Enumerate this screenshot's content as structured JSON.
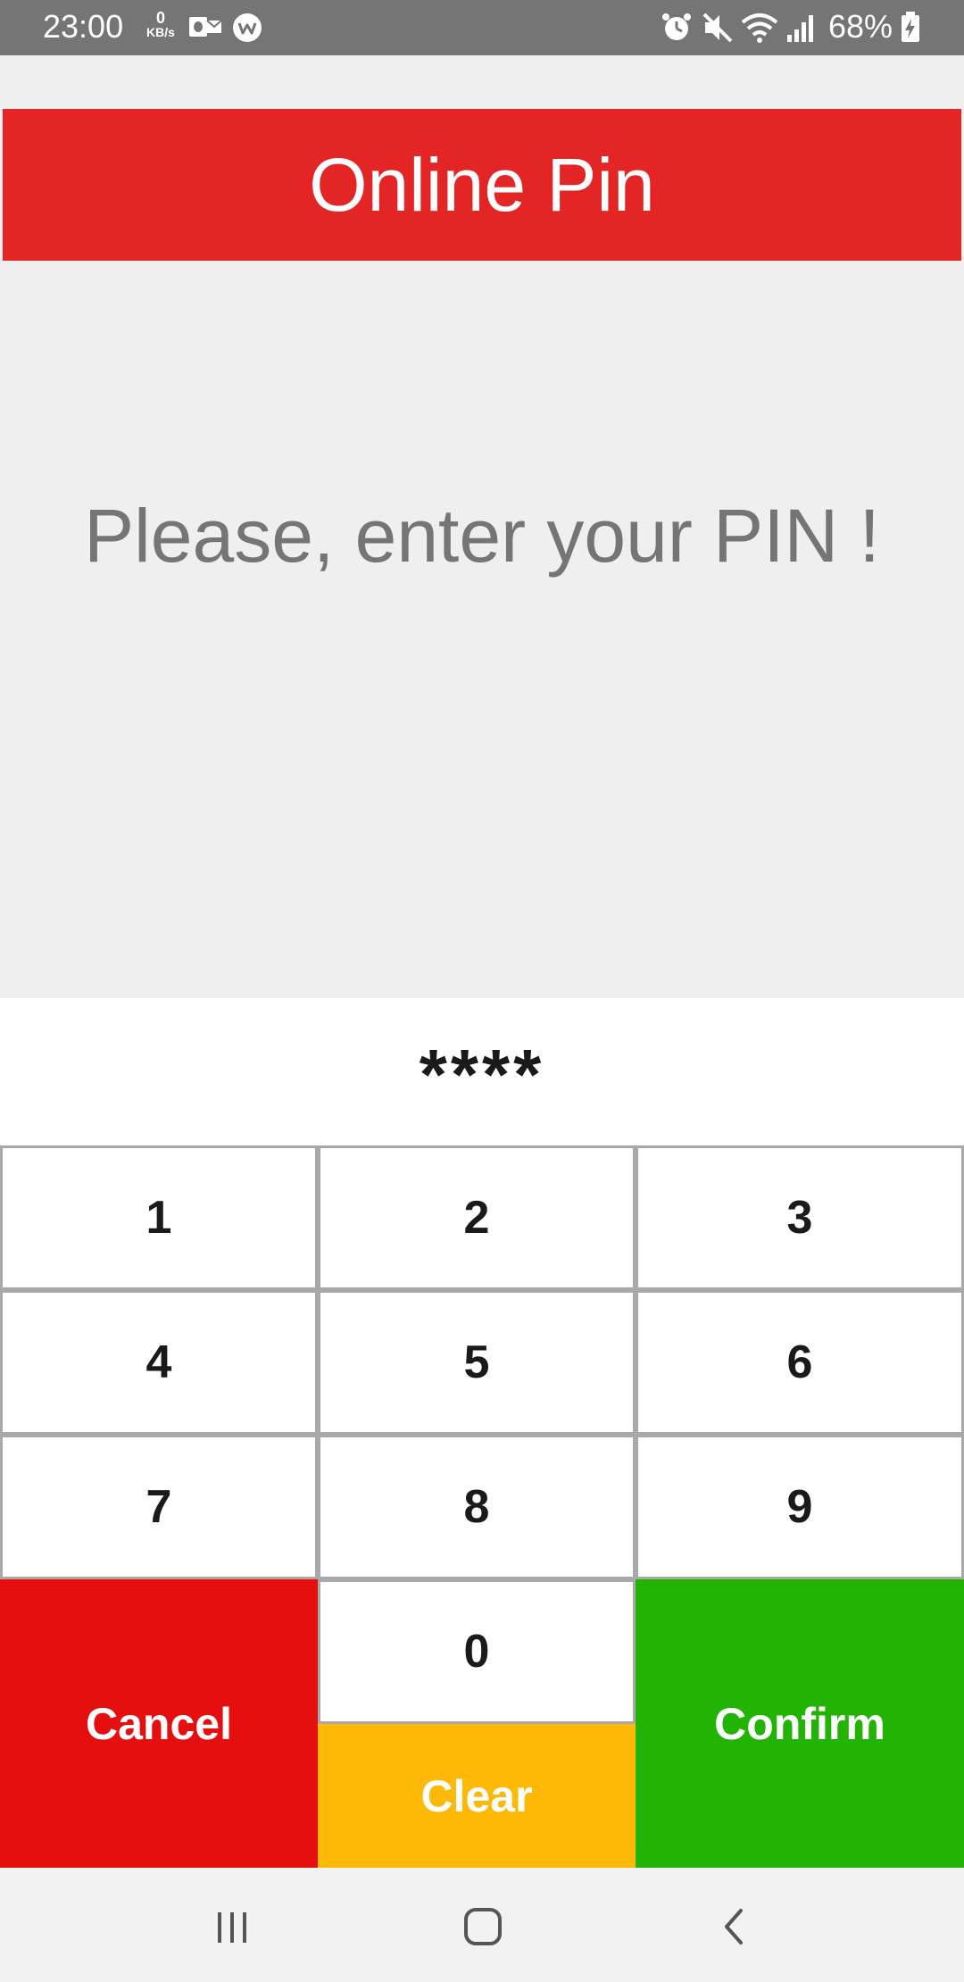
{
  "status_bar": {
    "time": "23:00",
    "net_speed_value": "0",
    "net_speed_unit": "KB/s",
    "battery_percent": "68%",
    "icons": [
      "outlook-icon",
      "chat-icon",
      "alarm-icon",
      "mute-icon",
      "wifi-icon",
      "signal-icon",
      "battery-charging-icon"
    ]
  },
  "header": {
    "title": "Online Pin"
  },
  "prompt": {
    "text": "Please, enter your PIN !"
  },
  "pin": {
    "value": "****"
  },
  "keypad": {
    "keys": [
      "1",
      "2",
      "3",
      "4",
      "5",
      "6",
      "7",
      "8",
      "9",
      "0"
    ],
    "cancel_label": "Cancel",
    "clear_label": "Clear",
    "confirm_label": "Confirm"
  },
  "colors": {
    "title_bg": "#e32526",
    "cancel_bg": "#e50f0f",
    "clear_bg": "#fdb808",
    "confirm_bg": "#23b304",
    "status_bar_bg": "#757575"
  },
  "nav_bar": {
    "icons": [
      "recent-apps-icon",
      "home-icon",
      "back-icon"
    ]
  }
}
